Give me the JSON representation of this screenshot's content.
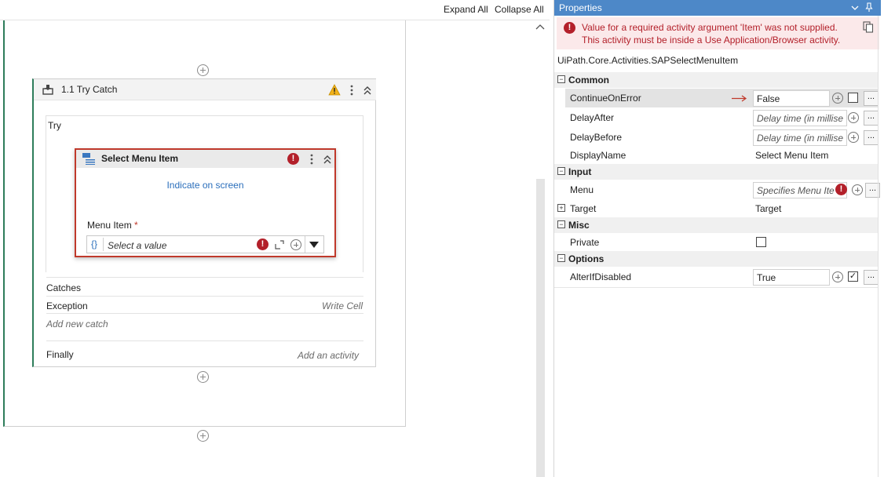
{
  "toolbar": {
    "expand_all": "Expand All",
    "collapse_all": "Collapse All"
  },
  "designer": {
    "try_catch": {
      "title": "1.1  Try Catch",
      "try_label": "Try",
      "catches_label": "Catches",
      "exception_label": "Exception",
      "exception_action": "Write Cell",
      "add_new_catch": "Add new catch",
      "finally_label": "Finally",
      "finally_action": "Add an activity"
    },
    "select_menu_item": {
      "title": "Select Menu Item",
      "indicate": "Indicate on screen",
      "menu_item_label": "Menu Item",
      "required_marker": "*",
      "placeholder": "Select a value",
      "brace_icon": "{}"
    }
  },
  "properties": {
    "title": "Properties",
    "error_line1": "Value for a required activity argument 'Item' was not supplied.",
    "error_line2": "This activity must be inside a Use Application/Browser activity.",
    "class_name": "UiPath.Core.Activities.SAPSelectMenuItem",
    "categories": {
      "common": "Common",
      "input": "Input",
      "misc": "Misc",
      "options": "Options"
    },
    "rows": {
      "continue_on_error": {
        "name": "ContinueOnError",
        "value": "False"
      },
      "delay_after": {
        "name": "DelayAfter",
        "value": "Delay time (in millise"
      },
      "delay_before": {
        "name": "DelayBefore",
        "value": "Delay time (in millise"
      },
      "display_name": {
        "name": "DisplayName",
        "value": "Select Menu Item"
      },
      "menu": {
        "name": "Menu",
        "value": "Specifies Menu Ite"
      },
      "target": {
        "name": "Target",
        "value": "Target"
      },
      "private": {
        "name": "Private"
      },
      "alter_if_disabled": {
        "name": "AlterIfDisabled",
        "value": "True"
      }
    },
    "ellipsis": "...",
    "accent_color": "#4d88c8",
    "error_color": "#b3202a"
  }
}
